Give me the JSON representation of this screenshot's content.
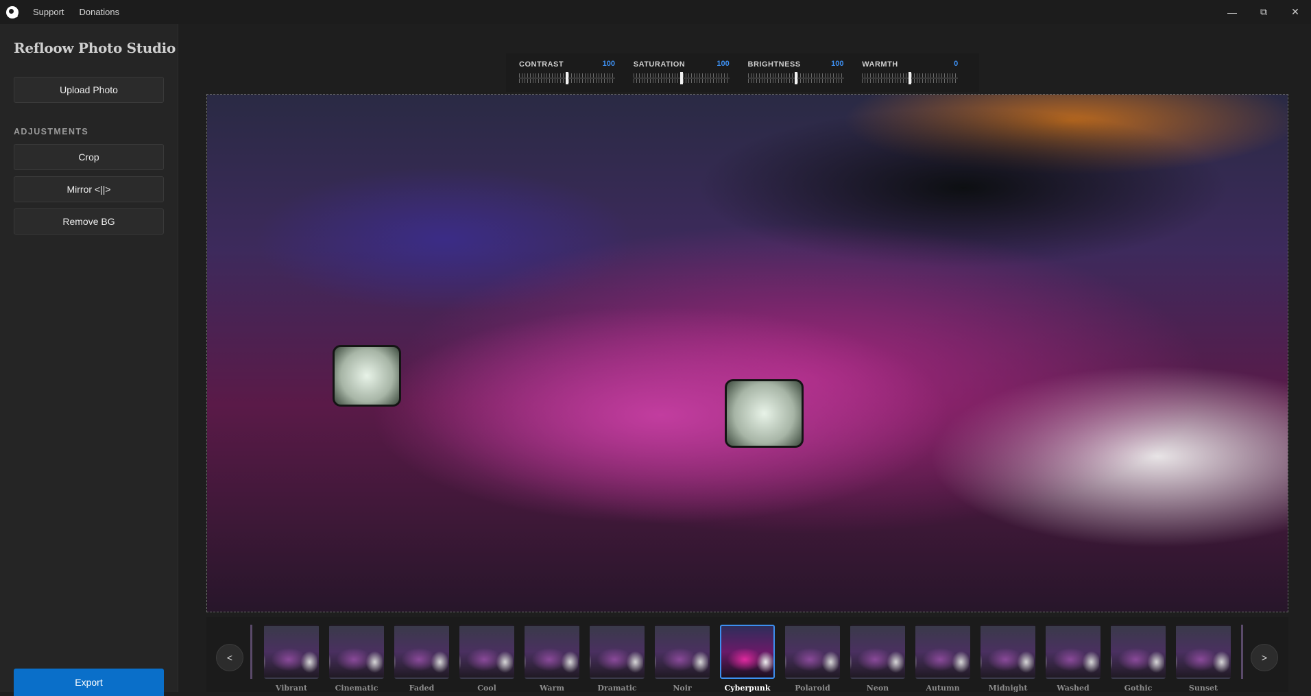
{
  "titlebar": {
    "menu": [
      "Support",
      "Donations"
    ],
    "controls": {
      "minimize": "—",
      "maximize": "⧉",
      "close": "✕"
    }
  },
  "sidebar": {
    "title": "Refloow Photo Studio",
    "upload_label": "Upload Photo",
    "section_label": "ADJUSTMENTS",
    "crop_label": "Crop",
    "mirror_label": "Mirror <||>",
    "remove_bg_label": "Remove BG",
    "export_label": "Export",
    "accent_color": "#0a6fc9"
  },
  "adjustments": [
    {
      "label": "CONTRAST",
      "value": "100",
      "level": 0.5
    },
    {
      "label": "SATURATION",
      "value": "100",
      "level": 0.5
    },
    {
      "label": "BRIGHTNESS",
      "value": "100",
      "level": 0.5
    },
    {
      "label": "WARMTH",
      "value": "0",
      "level": 0.5
    }
  ],
  "filters": {
    "prev_label": "<",
    "next_label": ">",
    "selected": "Cyberpunk",
    "items": [
      "Vibrant",
      "Cinematic",
      "Faded",
      "Cool",
      "Warm",
      "Dramatic",
      "Noir",
      "Cyberpunk",
      "Polaroid",
      "Neon",
      "Autumn",
      "Midnight",
      "Washed",
      "Gothic",
      "Sunset"
    ]
  }
}
